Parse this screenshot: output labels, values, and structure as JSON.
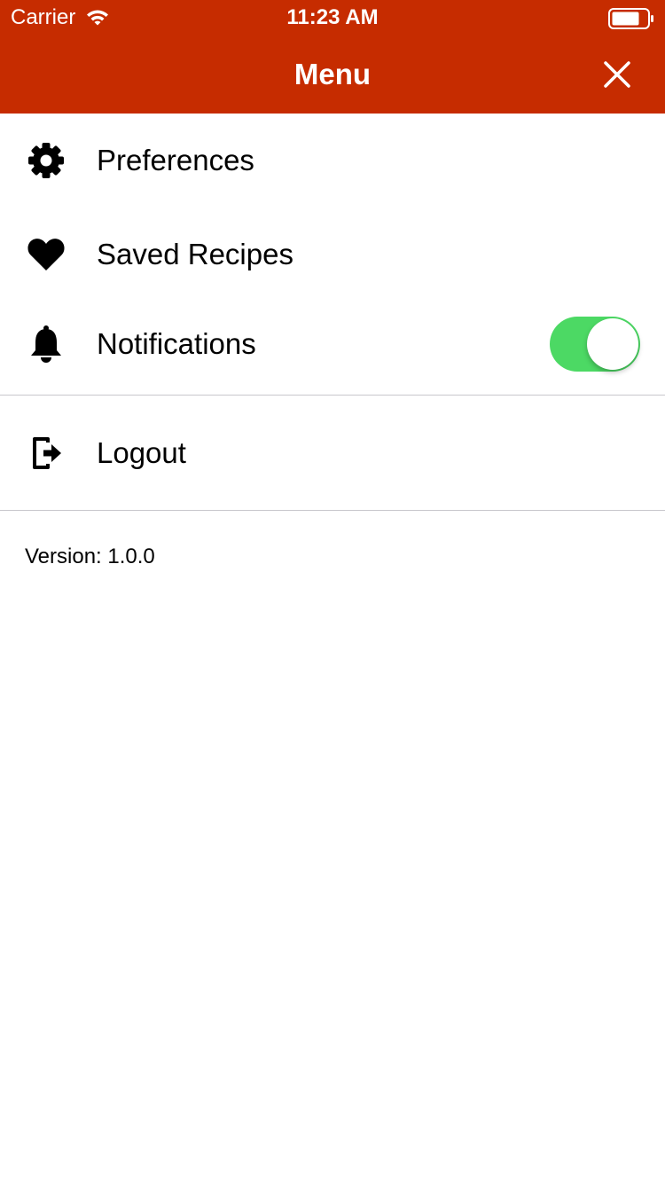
{
  "status_bar": {
    "carrier": "Carrier",
    "time": "11:23 AM",
    "wifi_icon": "wifi-icon",
    "battery_icon": "battery-icon"
  },
  "header": {
    "title": "Menu",
    "close_icon": "close-icon",
    "background_color": "#c62c00"
  },
  "menu": {
    "items": [
      {
        "label": "Preferences",
        "icon": "gear-icon"
      },
      {
        "label": "Saved Recipes",
        "icon": "heart-icon"
      },
      {
        "label": "Notifications",
        "icon": "bell-icon",
        "toggle_on": true
      },
      {
        "label": "Logout",
        "icon": "logout-icon"
      }
    ]
  },
  "toggle_color": "#4cd964",
  "footer": {
    "version": "Version: 1.0.0"
  }
}
